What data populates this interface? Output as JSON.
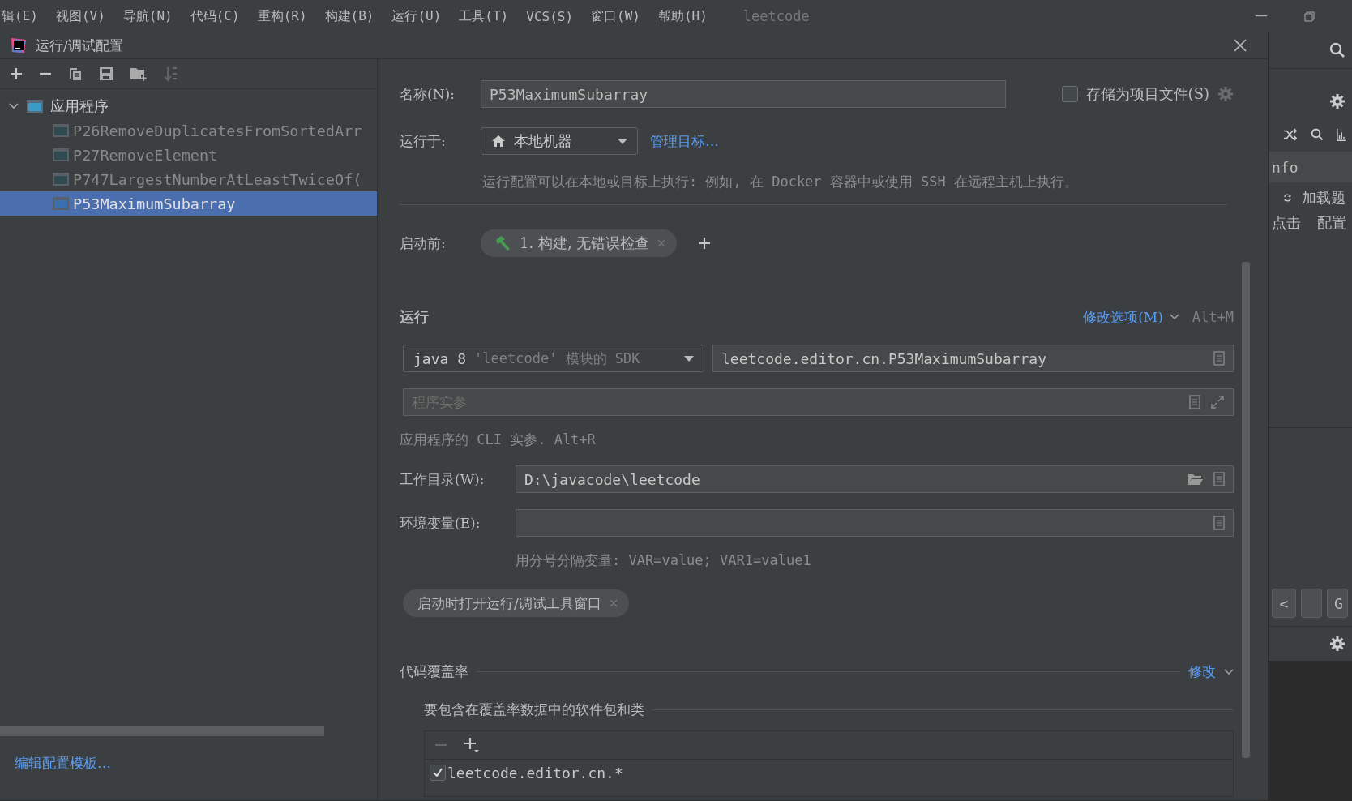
{
  "menu_bar": {
    "items": [
      "辑(E)",
      "视图(V)",
      "导航(N)",
      "代码(C)",
      "重构(R)",
      "构建(B)",
      "运行(U)",
      "工具(T)",
      "VCS(S)",
      "窗口(W)",
      "帮助(H)"
    ],
    "project": "leetcode"
  },
  "dialog": {
    "title": "运行/调试配置"
  },
  "tree": {
    "root": {
      "label": "应用程序",
      "expanded": true,
      "children": [
        {
          "label": "P26RemoveDuplicatesFromSortedArr",
          "selected": false
        },
        {
          "label": "P27RemoveElement",
          "selected": false
        },
        {
          "label": "P747LargestNumberAtLeastTwiceOf(",
          "selected": false
        },
        {
          "label": "P53MaximumSubarray",
          "selected": true
        }
      ]
    }
  },
  "edit_templates_link": "编辑配置模板…",
  "form": {
    "name_label": "名称(N):",
    "name_value": "P53MaximumSubarray",
    "store_as_file": {
      "label": "存储为项目文件(S)",
      "checked": false
    },
    "run_on_label": "运行于:",
    "run_on_value": "本地机器",
    "manage_targets_link": "管理目标…",
    "run_on_hint": "运行配置可以在本地或目标上执行: 例如, 在 Docker 容器中或使用 SSH 在远程主机上执行。",
    "before_launch_label": "启动前:",
    "before_launch_tasks": [
      "1. 构建, 无错误检查"
    ],
    "run_section": "运行",
    "modify_options_link": "修改选项(M)",
    "modify_options_shortcut": "Alt+M",
    "sdk_name": "java 8",
    "sdk_detail": "'leetcode' 模块的 SDK",
    "main_class": "leetcode.editor.cn.P53MaximumSubarray",
    "program_args_placeholder": "程序实参",
    "program_args_hint": "应用程序的 CLI 实参. Alt+R",
    "workdir_label": "工作目录(W):",
    "workdir_value": "D:\\javacode\\leetcode",
    "env_label": "环境变量(E):",
    "env_hint": "用分号分隔变量: VAR=value; VAR1=value1",
    "option_chips": [
      "启动时打开运行/调试工具窗口"
    ],
    "coverage_title": "代码覆盖率",
    "coverage_modify_link": "修改",
    "coverage_subtitle": "要包含在覆盖率数据中的软件包和类",
    "coverage_entries": [
      {
        "label": "leetcode.editor.cn.*",
        "checked": true
      }
    ]
  },
  "side_panel": {
    "header": "nfo",
    "row_1": "加载题",
    "row_2_left": "点击",
    "row_2_right": "配置",
    "buttons": [
      "<",
      "G"
    ]
  }
}
